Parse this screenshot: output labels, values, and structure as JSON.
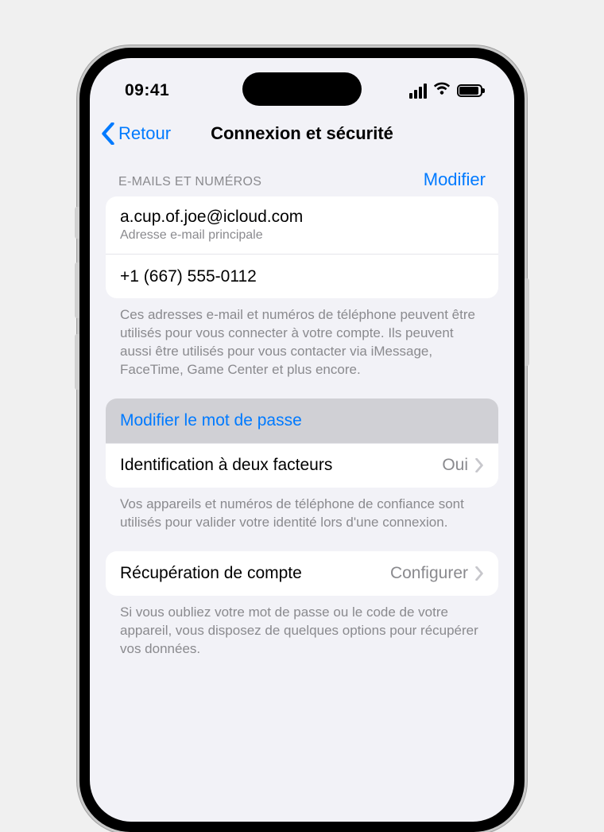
{
  "status": {
    "time": "09:41"
  },
  "nav": {
    "back_label": "Retour",
    "title": "Connexion et sécurité"
  },
  "emails_section": {
    "header": "E-mails et numéros",
    "edit_label": "Modifier",
    "rows": [
      {
        "primary": "a.cup.of.joe@icloud.com",
        "secondary": "Adresse e-mail principale"
      },
      {
        "primary": "+1 (667) 555-0112"
      }
    ],
    "footer": "Ces adresses e-mail et numéros de téléphone peuvent être utilisés pour vous connecter à votre compte. Ils peuvent aussi être utilisés pour vous contacter via iMessage, FaceTime, Game Center et plus encore."
  },
  "security_section": {
    "rows": [
      {
        "title": "Modifier le mot de passe"
      },
      {
        "title": "Identification à deux facteurs",
        "value": "Oui"
      }
    ],
    "footer": "Vos appareils et numéros de téléphone de confiance sont utilisés pour valider votre identité lors d'une connexion."
  },
  "recovery_section": {
    "rows": [
      {
        "title": "Récupération de compte",
        "value": "Configurer"
      }
    ],
    "footer": "Si vous oubliez votre mot de passe ou le code de votre appareil, vous disposez de quelques options pour récupérer vos données."
  }
}
